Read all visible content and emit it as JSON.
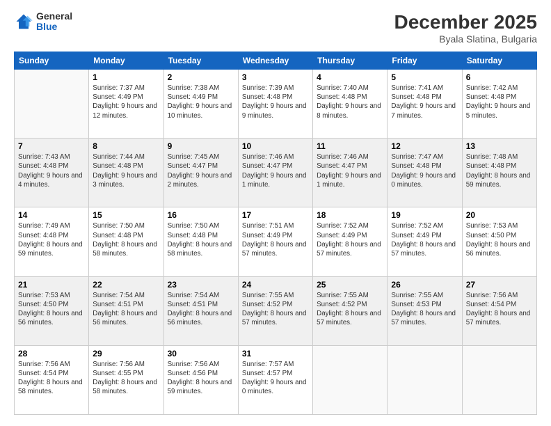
{
  "header": {
    "logo_general": "General",
    "logo_blue": "Blue",
    "month_title": "December 2025",
    "location": "Byala Slatina, Bulgaria"
  },
  "weekdays": [
    "Sunday",
    "Monday",
    "Tuesday",
    "Wednesday",
    "Thursday",
    "Friday",
    "Saturday"
  ],
  "weeks": [
    [
      {
        "day": "",
        "sunrise": "",
        "sunset": "",
        "daylight": ""
      },
      {
        "day": "1",
        "sunrise": "Sunrise: 7:37 AM",
        "sunset": "Sunset: 4:49 PM",
        "daylight": "Daylight: 9 hours and 12 minutes."
      },
      {
        "day": "2",
        "sunrise": "Sunrise: 7:38 AM",
        "sunset": "Sunset: 4:49 PM",
        "daylight": "Daylight: 9 hours and 10 minutes."
      },
      {
        "day": "3",
        "sunrise": "Sunrise: 7:39 AM",
        "sunset": "Sunset: 4:48 PM",
        "daylight": "Daylight: 9 hours and 9 minutes."
      },
      {
        "day": "4",
        "sunrise": "Sunrise: 7:40 AM",
        "sunset": "Sunset: 4:48 PM",
        "daylight": "Daylight: 9 hours and 8 minutes."
      },
      {
        "day": "5",
        "sunrise": "Sunrise: 7:41 AM",
        "sunset": "Sunset: 4:48 PM",
        "daylight": "Daylight: 9 hours and 7 minutes."
      },
      {
        "day": "6",
        "sunrise": "Sunrise: 7:42 AM",
        "sunset": "Sunset: 4:48 PM",
        "daylight": "Daylight: 9 hours and 5 minutes."
      }
    ],
    [
      {
        "day": "7",
        "sunrise": "Sunrise: 7:43 AM",
        "sunset": "Sunset: 4:48 PM",
        "daylight": "Daylight: 9 hours and 4 minutes."
      },
      {
        "day": "8",
        "sunrise": "Sunrise: 7:44 AM",
        "sunset": "Sunset: 4:48 PM",
        "daylight": "Daylight: 9 hours and 3 minutes."
      },
      {
        "day": "9",
        "sunrise": "Sunrise: 7:45 AM",
        "sunset": "Sunset: 4:47 PM",
        "daylight": "Daylight: 9 hours and 2 minutes."
      },
      {
        "day": "10",
        "sunrise": "Sunrise: 7:46 AM",
        "sunset": "Sunset: 4:47 PM",
        "daylight": "Daylight: 9 hours and 1 minute."
      },
      {
        "day": "11",
        "sunrise": "Sunrise: 7:46 AM",
        "sunset": "Sunset: 4:47 PM",
        "daylight": "Daylight: 9 hours and 1 minute."
      },
      {
        "day": "12",
        "sunrise": "Sunrise: 7:47 AM",
        "sunset": "Sunset: 4:48 PM",
        "daylight": "Daylight: 9 hours and 0 minutes."
      },
      {
        "day": "13",
        "sunrise": "Sunrise: 7:48 AM",
        "sunset": "Sunset: 4:48 PM",
        "daylight": "Daylight: 8 hours and 59 minutes."
      }
    ],
    [
      {
        "day": "14",
        "sunrise": "Sunrise: 7:49 AM",
        "sunset": "Sunset: 4:48 PM",
        "daylight": "Daylight: 8 hours and 59 minutes."
      },
      {
        "day": "15",
        "sunrise": "Sunrise: 7:50 AM",
        "sunset": "Sunset: 4:48 PM",
        "daylight": "Daylight: 8 hours and 58 minutes."
      },
      {
        "day": "16",
        "sunrise": "Sunrise: 7:50 AM",
        "sunset": "Sunset: 4:48 PM",
        "daylight": "Daylight: 8 hours and 58 minutes."
      },
      {
        "day": "17",
        "sunrise": "Sunrise: 7:51 AM",
        "sunset": "Sunset: 4:49 PM",
        "daylight": "Daylight: 8 hours and 57 minutes."
      },
      {
        "day": "18",
        "sunrise": "Sunrise: 7:52 AM",
        "sunset": "Sunset: 4:49 PM",
        "daylight": "Daylight: 8 hours and 57 minutes."
      },
      {
        "day": "19",
        "sunrise": "Sunrise: 7:52 AM",
        "sunset": "Sunset: 4:49 PM",
        "daylight": "Daylight: 8 hours and 57 minutes."
      },
      {
        "day": "20",
        "sunrise": "Sunrise: 7:53 AM",
        "sunset": "Sunset: 4:50 PM",
        "daylight": "Daylight: 8 hours and 56 minutes."
      }
    ],
    [
      {
        "day": "21",
        "sunrise": "Sunrise: 7:53 AM",
        "sunset": "Sunset: 4:50 PM",
        "daylight": "Daylight: 8 hours and 56 minutes."
      },
      {
        "day": "22",
        "sunrise": "Sunrise: 7:54 AM",
        "sunset": "Sunset: 4:51 PM",
        "daylight": "Daylight: 8 hours and 56 minutes."
      },
      {
        "day": "23",
        "sunrise": "Sunrise: 7:54 AM",
        "sunset": "Sunset: 4:51 PM",
        "daylight": "Daylight: 8 hours and 56 minutes."
      },
      {
        "day": "24",
        "sunrise": "Sunrise: 7:55 AM",
        "sunset": "Sunset: 4:52 PM",
        "daylight": "Daylight: 8 hours and 57 minutes."
      },
      {
        "day": "25",
        "sunrise": "Sunrise: 7:55 AM",
        "sunset": "Sunset: 4:52 PM",
        "daylight": "Daylight: 8 hours and 57 minutes."
      },
      {
        "day": "26",
        "sunrise": "Sunrise: 7:55 AM",
        "sunset": "Sunset: 4:53 PM",
        "daylight": "Daylight: 8 hours and 57 minutes."
      },
      {
        "day": "27",
        "sunrise": "Sunrise: 7:56 AM",
        "sunset": "Sunset: 4:54 PM",
        "daylight": "Daylight: 8 hours and 57 minutes."
      }
    ],
    [
      {
        "day": "28",
        "sunrise": "Sunrise: 7:56 AM",
        "sunset": "Sunset: 4:54 PM",
        "daylight": "Daylight: 8 hours and 58 minutes."
      },
      {
        "day": "29",
        "sunrise": "Sunrise: 7:56 AM",
        "sunset": "Sunset: 4:55 PM",
        "daylight": "Daylight: 8 hours and 58 minutes."
      },
      {
        "day": "30",
        "sunrise": "Sunrise: 7:56 AM",
        "sunset": "Sunset: 4:56 PM",
        "daylight": "Daylight: 8 hours and 59 minutes."
      },
      {
        "day": "31",
        "sunrise": "Sunrise: 7:57 AM",
        "sunset": "Sunset: 4:57 PM",
        "daylight": "Daylight: 9 hours and 0 minutes."
      },
      {
        "day": "",
        "sunrise": "",
        "sunset": "",
        "daylight": ""
      },
      {
        "day": "",
        "sunrise": "",
        "sunset": "",
        "daylight": ""
      },
      {
        "day": "",
        "sunrise": "",
        "sunset": "",
        "daylight": ""
      }
    ]
  ]
}
